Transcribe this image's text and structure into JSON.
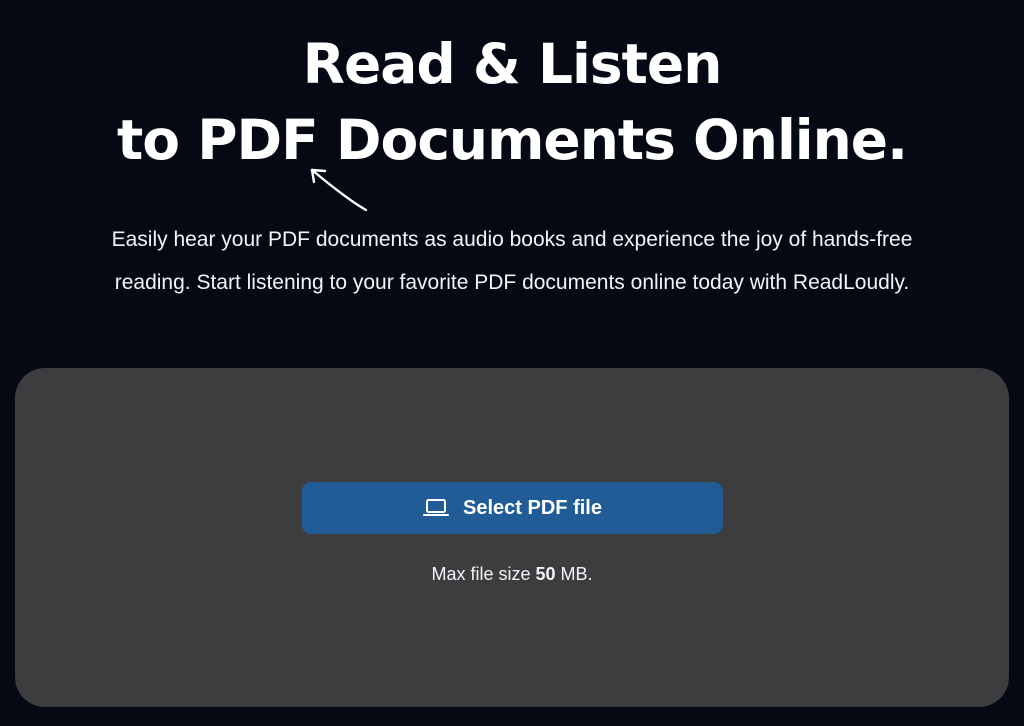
{
  "hero": {
    "title_line1": "Read & Listen",
    "title_line2": "to PDF Documents Online.",
    "subtitle_line1": "Easily hear your PDF documents as audio books and experience the joy of hands-free",
    "subtitle_line2": "reading. Start listening to your favorite PDF documents online today with ReadLoudly."
  },
  "upload": {
    "button_label": "Select PDF file",
    "button_icon": "laptop-icon",
    "note_prefix": "Max file size ",
    "note_value": "50",
    "note_suffix": " MB."
  },
  "colors": {
    "background": "#040914",
    "panel": "#3d3d3f",
    "button": "#215c96",
    "text": "#ffffff"
  }
}
